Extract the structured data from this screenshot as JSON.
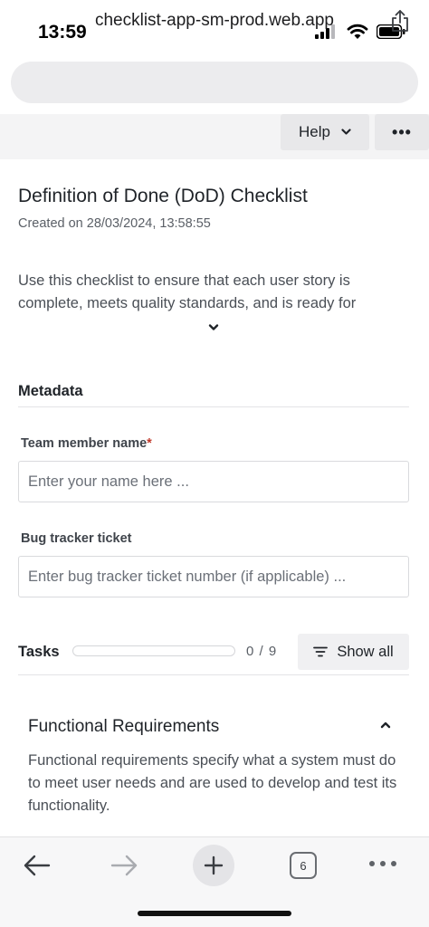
{
  "status_bar": {
    "time": "13:59"
  },
  "browser": {
    "url": "checklist-app-sm-prod.web.app",
    "tab_count": "6"
  },
  "toolbar": {
    "help_label": "Help",
    "more_label": "•••"
  },
  "checklist": {
    "title": "Definition of Done (DoD) Checklist",
    "created": "Created on 28/03/2024, 13:58:55",
    "description": "Use this checklist to ensure that each user story is complete, meets quality standards, and is ready for"
  },
  "metadata": {
    "heading": "Metadata",
    "team_member": {
      "label": "Team member name",
      "required_mark": "*",
      "placeholder": "Enter your name here ..."
    },
    "bug_ticket": {
      "label": "Bug tracker ticket",
      "placeholder": "Enter bug tracker ticket number (if applicable) ..."
    }
  },
  "tasks": {
    "heading": "Tasks",
    "completed": 0,
    "total": 9,
    "count_label": "0 / 9",
    "show_all_label": "Show all"
  },
  "functional_requirements": {
    "title": "Functional Requirements",
    "description": "Functional requirements specify what a system must do to meet user needs and are used to develop and test its functionality."
  },
  "colors": {
    "accent": "#3a7bd5",
    "required": "#c0392b"
  }
}
